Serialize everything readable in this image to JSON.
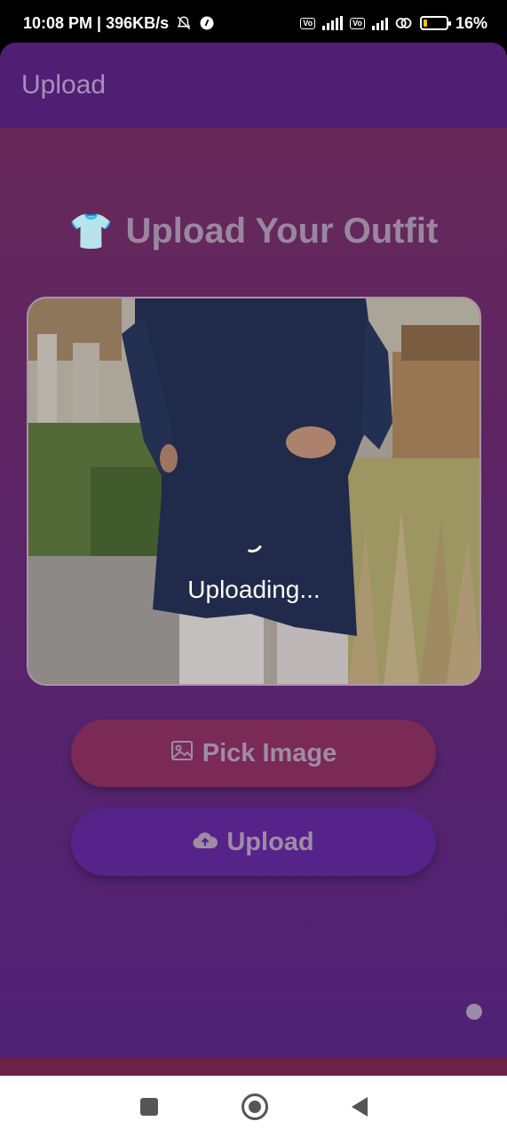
{
  "status_bar": {
    "time_speed": "10:08 PM | 396KB/s",
    "mute_icon": "bell-off-icon",
    "battery_percent": "16%",
    "battery_level": 0.16,
    "battery_color": "#f1c40f"
  },
  "app_bar": {
    "title": "Upload"
  },
  "heading": {
    "icon": "👕",
    "title": "Upload Your Outfit"
  },
  "image_card": {
    "status_text": "Uploading..."
  },
  "buttons": {
    "pick_image": {
      "icon": "image-icon",
      "label": "Pick Image",
      "color": "#7a2a55"
    },
    "upload": {
      "icon": "cloud-upload-icon",
      "label": "Upload",
      "color": "#56238a"
    }
  },
  "colors": {
    "app_bar": "#4f1f74",
    "text_muted": "#9f8ba6"
  }
}
